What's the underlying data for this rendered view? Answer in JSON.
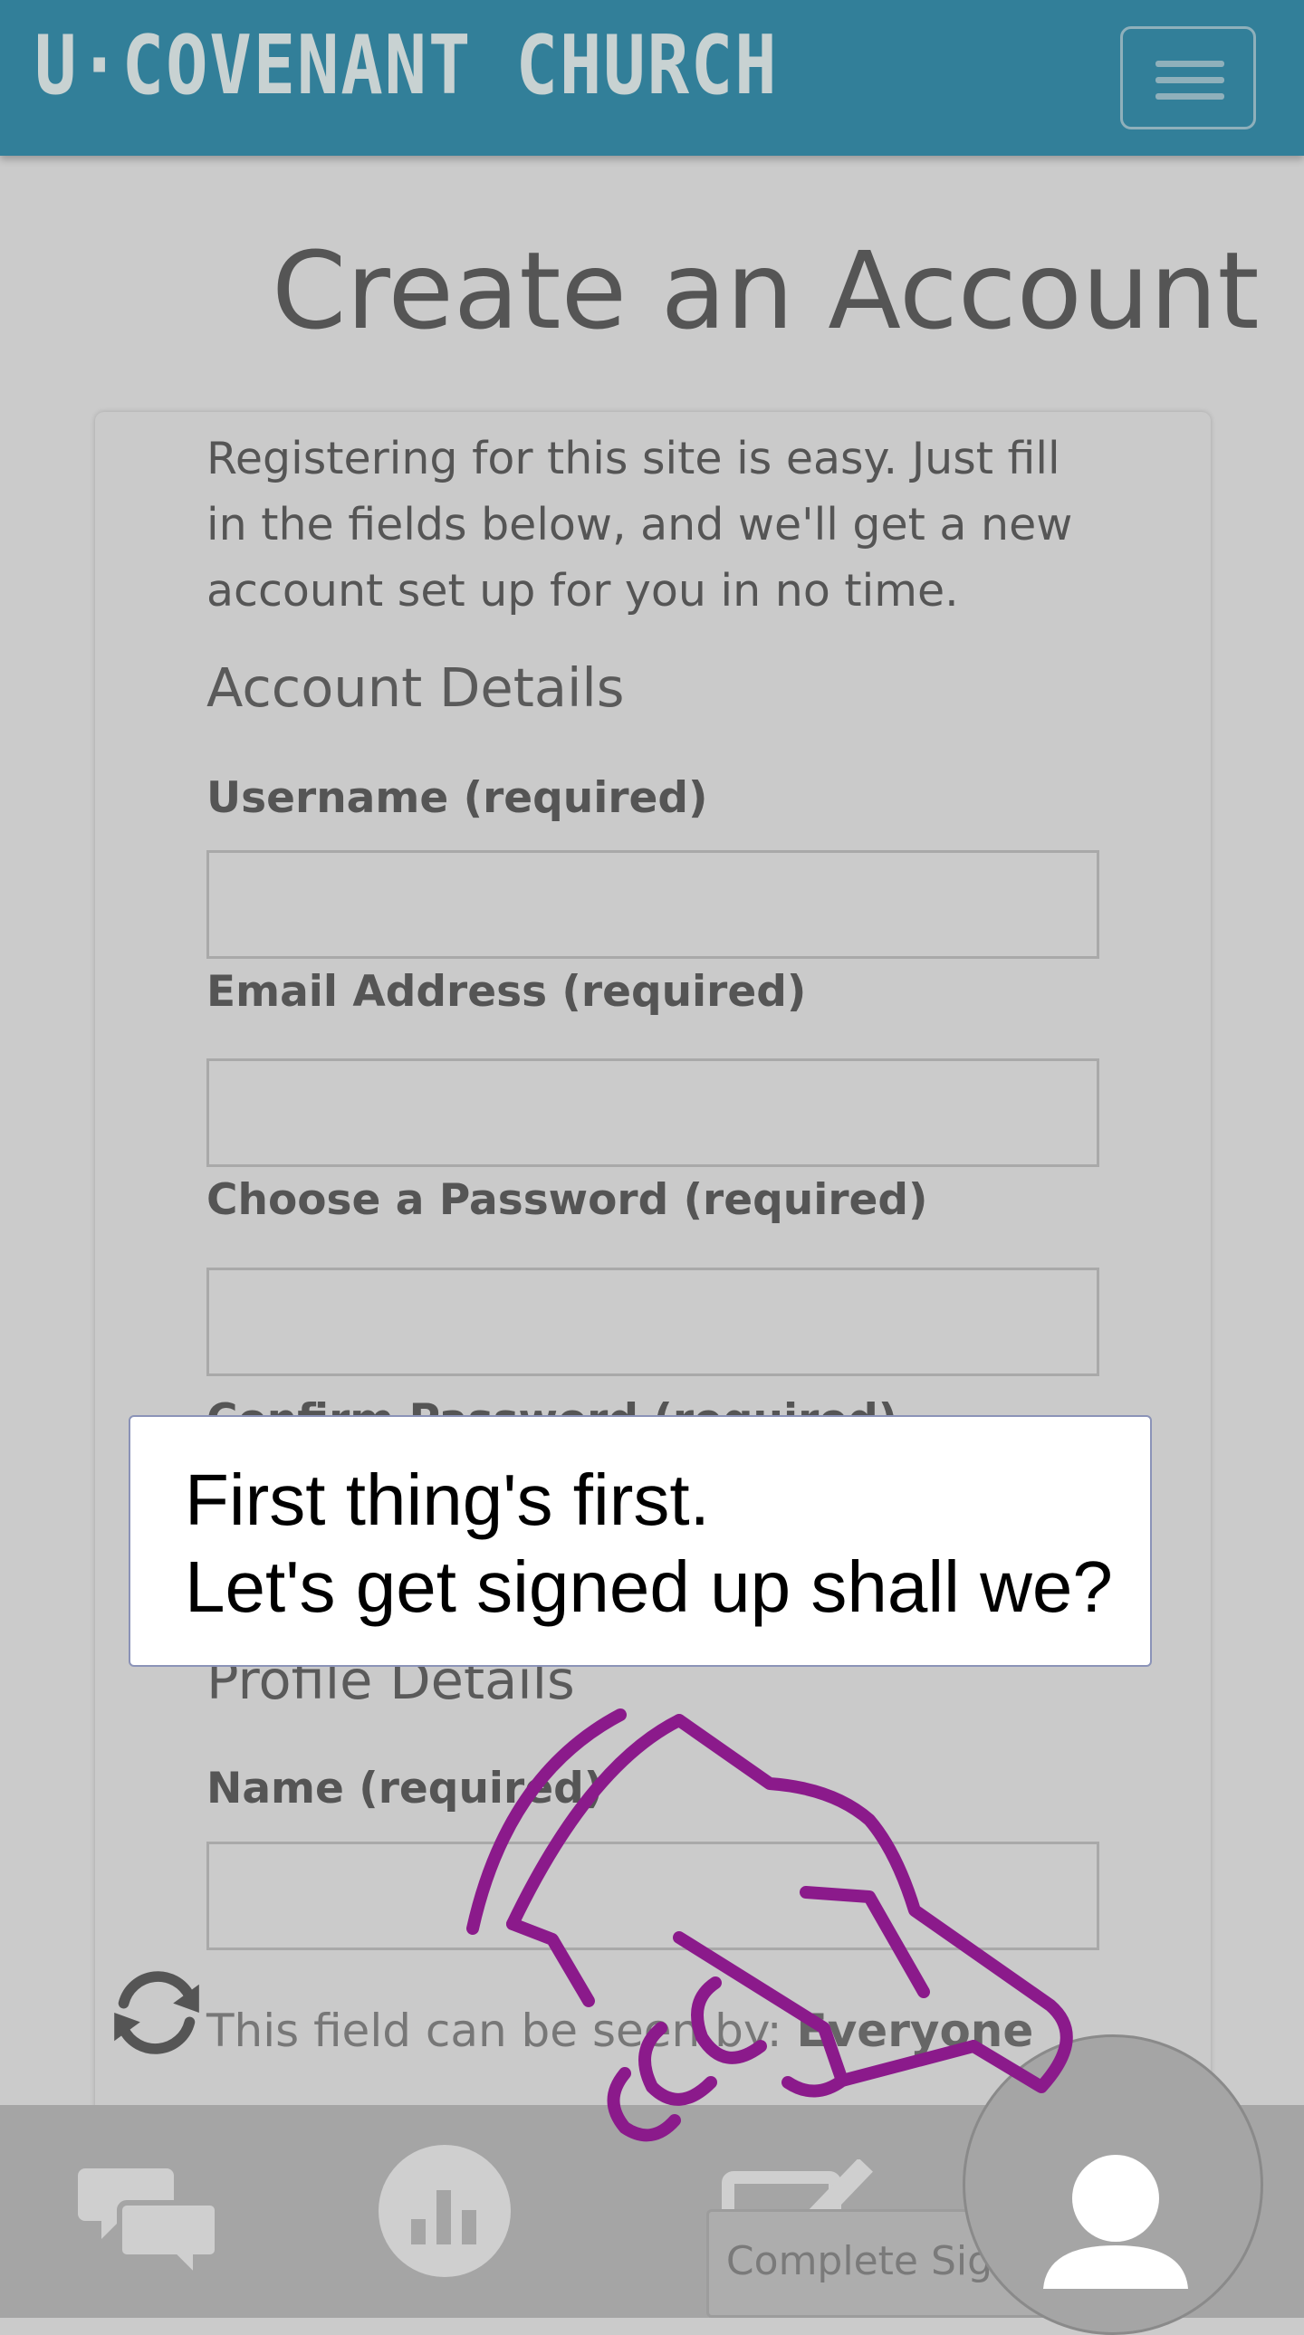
{
  "header": {
    "brand": "U·COVENANT CHURCH"
  },
  "page": {
    "title": "Create an Account",
    "intro": "Registering for this site is easy. Just fill in the fields below, and we'll get a new account set up for you in no time."
  },
  "account_details": {
    "heading": "Account Details",
    "fields": [
      {
        "label": "Username (required)",
        "value": ""
      },
      {
        "label": "Email Address (required)",
        "value": ""
      },
      {
        "label": "Choose a Password (required)",
        "value": ""
      },
      {
        "label": "Confirm Password (required)",
        "value": ""
      }
    ]
  },
  "profile_details": {
    "heading": "Profile Details",
    "name_label": "Name (required)",
    "name_value": "",
    "visibility_prefix": "This field can be seen by: ",
    "visibility_value": "Everyone"
  },
  "tooltip": {
    "text": "First thing's first.\nLet's get signed up shall we?"
  },
  "footer": {
    "complete_signup": "Complete Sign Up"
  },
  "colors": {
    "header": "#327f99",
    "overlay_bg": "#cbcbcb",
    "pointer": "#8b1a8b"
  },
  "icons": [
    "menu-icon",
    "refresh-icon",
    "chat-icon",
    "chart-icon",
    "checkbox-icon",
    "user-icon",
    "hand-pointer-icon"
  ]
}
